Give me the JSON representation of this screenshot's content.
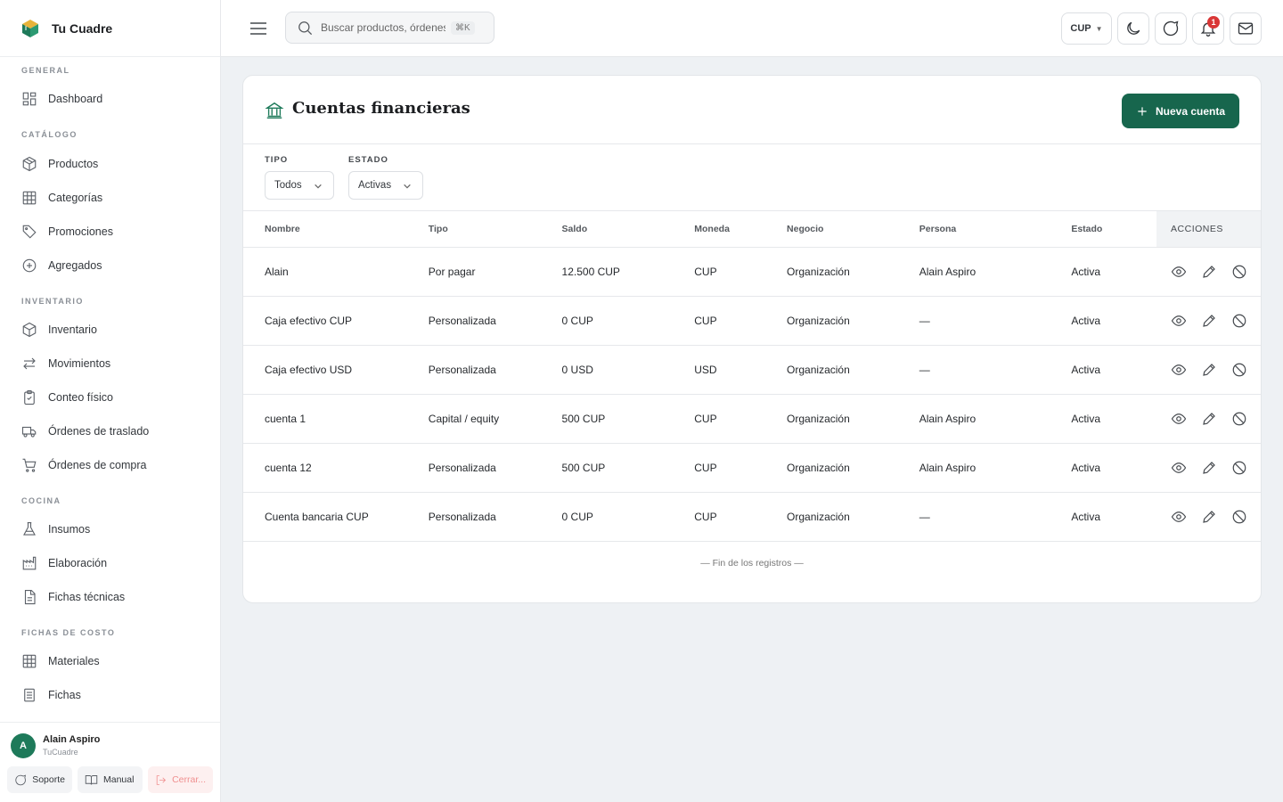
{
  "brand": {
    "name": "Tu Cuadre"
  },
  "sidebar": {
    "sections": [
      {
        "label": "GENERAL",
        "items": [
          {
            "label": "Dashboard",
            "icon": "dashboard-icon"
          }
        ]
      },
      {
        "label": "CATÁLOGO",
        "items": [
          {
            "label": "Productos",
            "icon": "box-icon"
          },
          {
            "label": "Categorías",
            "icon": "grid-icon"
          },
          {
            "label": "Promociones",
            "icon": "tag-icon"
          },
          {
            "label": "Agregados",
            "icon": "plus-circle-icon"
          }
        ]
      },
      {
        "label": "INVENTARIO",
        "items": [
          {
            "label": "Inventario",
            "icon": "box-icon"
          },
          {
            "label": "Movimientos",
            "icon": "arrows-icon"
          },
          {
            "label": "Conteo físico",
            "icon": "clipboard-icon"
          },
          {
            "label": "Órdenes de traslado",
            "icon": "truck-icon"
          },
          {
            "label": "Órdenes de compra",
            "icon": "cart-icon"
          }
        ]
      },
      {
        "label": "COCINA",
        "items": [
          {
            "label": "Insumos",
            "icon": "flask-icon"
          },
          {
            "label": "Elaboración",
            "icon": "factory-icon"
          },
          {
            "label": "Fichas técnicas",
            "icon": "document-icon"
          }
        ]
      },
      {
        "label": "FICHAS DE COSTO",
        "items": [
          {
            "label": "Materiales",
            "icon": "grid-icon"
          },
          {
            "label": "Fichas",
            "icon": "document-icon"
          }
        ]
      }
    ]
  },
  "user": {
    "initial": "A",
    "name": "Alain Aspiro",
    "org": "TuCuadre"
  },
  "footer": {
    "support": "Soporte",
    "manual": "Manual",
    "logout": "Cerrar..."
  },
  "header": {
    "search_placeholder": "Buscar productos, órdenes",
    "shortcut": "⌘K",
    "currency": "CUP",
    "notifications_count": "1"
  },
  "page": {
    "title": "Cuentas financieras",
    "new_button": "Nueva cuenta"
  },
  "filters": {
    "type_label": "TIPO",
    "type_value": "Todos",
    "state_label": "ESTADO",
    "state_value": "Activas"
  },
  "table": {
    "columns": [
      "Nombre",
      "Tipo",
      "Saldo",
      "Moneda",
      "Negocio",
      "Persona",
      "Estado",
      "ACCIONES"
    ],
    "rows": [
      [
        "Alain",
        "Por pagar",
        "12.500 CUP",
        "CUP",
        "Organización",
        "Alain Aspiro",
        "Activa"
      ],
      [
        "Caja efectivo CUP",
        "Personalizada",
        "0 CUP",
        "CUP",
        "Organización",
        "—",
        "Activa"
      ],
      [
        "Caja efectivo USD",
        "Personalizada",
        "0 USD",
        "USD",
        "Organización",
        "—",
        "Activa"
      ],
      [
        "cuenta 1",
        "Capital / equity",
        "500 CUP",
        "CUP",
        "Organización",
        "Alain Aspiro",
        "Activa"
      ],
      [
        "cuenta 12",
        "Personalizada",
        "500 CUP",
        "CUP",
        "Organización",
        "Alain Aspiro",
        "Activa"
      ],
      [
        "Cuenta bancaria CUP",
        "Personalizada",
        "0 CUP",
        "CUP",
        "Organización",
        "—",
        "Activa"
      ]
    ],
    "end_note": "— Fin de los registros —"
  }
}
